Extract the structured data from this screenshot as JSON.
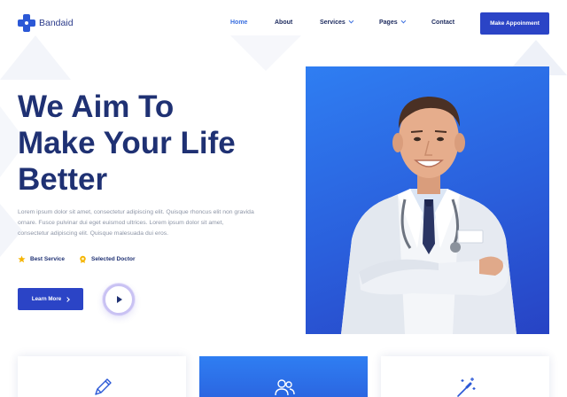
{
  "brand": {
    "name": "Bandaid",
    "color": "#2b58d6"
  },
  "nav": {
    "items": [
      {
        "label": "Home",
        "active": true,
        "dropdown": false
      },
      {
        "label": "About",
        "active": false,
        "dropdown": false
      },
      {
        "label": "Services",
        "active": false,
        "dropdown": true
      },
      {
        "label": "Pages",
        "active": false,
        "dropdown": true
      },
      {
        "label": "Contact",
        "active": false,
        "dropdown": false
      }
    ],
    "cta_label": "Make Appoinment"
  },
  "hero": {
    "title_line1": "We Aim To",
    "title_line2": "Make Your Life",
    "title_line3": "Better",
    "description": "Lorem ipsum dolor sit amet, consectetur adipiscing elit. Quisque rhoncus elit non gravida ornare. Fusce pulvinar dui eget euismod ultrices. Lorem ipsum dolor sit amet, consectetur adipiscing elit. Quisque malesuada dui eros.",
    "features": [
      {
        "label": "Best Service",
        "icon": "star-icon"
      },
      {
        "label": "Selected Doctor",
        "icon": "badge-icon"
      }
    ],
    "learn_more_label": "Learn More",
    "play_icon": "play-icon",
    "image_subject": "doctor-photo"
  },
  "cards": [
    {
      "icon": "pencil-icon",
      "highlighted": false
    },
    {
      "icon": "users-icon",
      "highlighted": true
    },
    {
      "icon": "magic-wand-icon",
      "highlighted": false
    }
  ],
  "colors": {
    "primary": "#2b44c6",
    "accent": "#3a6fe0",
    "heading": "#1f3173",
    "star": "#f5b400"
  }
}
